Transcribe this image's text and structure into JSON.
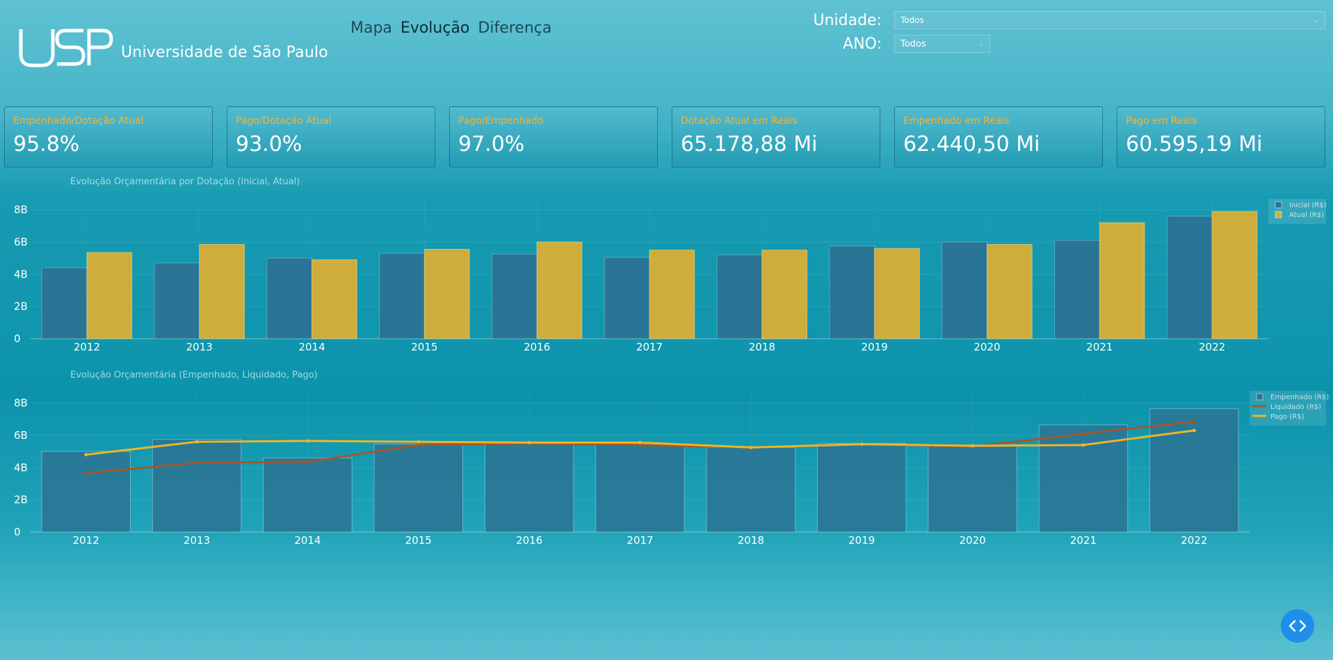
{
  "header": {
    "logo_text": "Universidade de São Paulo",
    "nav": [
      {
        "label": "Mapa",
        "active": false
      },
      {
        "label": "Evolução",
        "active": true
      },
      {
        "label": "Diferença",
        "active": false
      }
    ]
  },
  "filters": {
    "unidade": {
      "label": "Unidade:",
      "value": "Todos"
    },
    "ano": {
      "label": "ANO:",
      "value": "Todos"
    }
  },
  "kpis": [
    {
      "label": "Empenhado/Dotação Atual",
      "value": "95.8%"
    },
    {
      "label": "Pago/Dotação Atual",
      "value": "93.0%"
    },
    {
      "label": "Pago/Empenhado",
      "value": "97.0%"
    },
    {
      "label": "Dotação Atual em Reais",
      "value": "65.178,88 Mi"
    },
    {
      "label": "Empenhado em Reais",
      "value": "62.440,50 Mi"
    },
    {
      "label": "Pago em Reais",
      "value": "60.595,19 Mi"
    }
  ],
  "colors": {
    "accent": "#f5b335",
    "bar_blue": "#2a7595",
    "bar_gold": "#cfad3c",
    "line_liquidado": "#a0582c",
    "line_pago": "#f0b428"
  },
  "chart_data": [
    {
      "type": "bar",
      "title": "Evolução Orçamentária por Dotação (Inicial, Atual)",
      "categories": [
        "2012",
        "2013",
        "2014",
        "2015",
        "2016",
        "2017",
        "2018",
        "2019",
        "2020",
        "2021",
        "2022"
      ],
      "series": [
        {
          "name": "Inicial (R$)",
          "values": [
            4.4,
            4.7,
            5.0,
            5.3,
            5.25,
            5.05,
            5.2,
            5.75,
            6.0,
            6.1,
            7.6
          ]
        },
        {
          "name": "Atual (R$)",
          "values": [
            5.35,
            5.85,
            4.9,
            5.55,
            6.0,
            5.5,
            5.5,
            5.6,
            5.85,
            7.2,
            7.9
          ]
        }
      ],
      "y_ticks": [
        "0",
        "2B",
        "4B",
        "6B",
        "8B"
      ],
      "ylim": [
        0,
        8.5
      ],
      "legend": "top-right"
    },
    {
      "type": "bar",
      "title": "Evolução Orçamentária (Empenhado, Liquidado, Pago)",
      "categories": [
        "2012",
        "2013",
        "2014",
        "2015",
        "2016",
        "2017",
        "2018",
        "2019",
        "2020",
        "2021",
        "2022"
      ],
      "series": [
        {
          "name": "Empenhado (R$)",
          "type": "bar",
          "values": [
            5.0,
            5.75,
            4.6,
            5.45,
            5.5,
            5.45,
            5.25,
            5.5,
            5.4,
            6.65,
            7.65
          ]
        },
        {
          "name": "Liquidado (R$)",
          "type": "line",
          "values": [
            3.65,
            4.3,
            4.35,
            5.4,
            5.5,
            5.4,
            5.25,
            5.45,
            5.3,
            6.1,
            6.85
          ]
        },
        {
          "name": "Pago (R$)",
          "type": "line",
          "values": [
            4.8,
            5.6,
            5.65,
            5.6,
            5.55,
            5.55,
            5.25,
            5.45,
            5.35,
            5.4,
            6.3
          ]
        }
      ],
      "y_ticks": [
        "0",
        "2B",
        "4B",
        "6B",
        "8B"
      ],
      "ylim": [
        0,
        8.5
      ],
      "legend": "top-right"
    }
  ]
}
